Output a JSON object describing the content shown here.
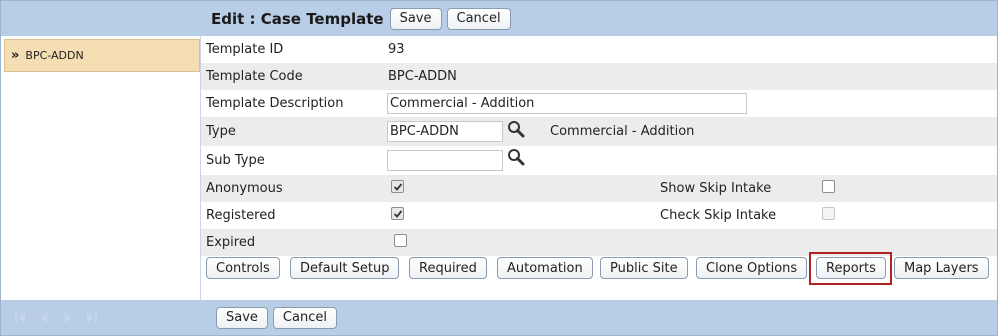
{
  "left": {
    "selected_item": "BPC-ADDN",
    "chevron": "»",
    "pager_icons": [
      "first-page-icon",
      "prev-page-icon",
      "next-page-icon",
      "last-page-icon"
    ]
  },
  "header": {
    "title": "Edit : Case Template",
    "save_label": "Save",
    "cancel_label": "Cancel"
  },
  "form": {
    "template_id_label": "Template ID",
    "template_id_value": "93",
    "template_code_label": "Template Code",
    "template_code_value": "BPC-ADDN",
    "template_description_label": "Template Description",
    "template_description_value": "Commercial - Addition",
    "type_label": "Type",
    "type_value": "BPC-ADDN",
    "type_description": "Commercial - Addition",
    "sub_type_label": "Sub Type",
    "sub_type_value": "",
    "anonymous_label": "Anonymous",
    "anonymous_checked": true,
    "show_skip_intake_label": "Show Skip Intake",
    "show_skip_intake_checked": false,
    "registered_label": "Registered",
    "registered_checked": true,
    "check_skip_intake_label": "Check Skip Intake",
    "check_skip_intake_checked": false,
    "expired_label": "Expired",
    "expired_checked": false
  },
  "actions": {
    "controls": "Controls",
    "default_setup": "Default Setup",
    "required": "Required",
    "automation": "Automation",
    "public_site": "Public Site",
    "clone_options": "Clone Options",
    "reports": "Reports",
    "map_layers": "Map Layers"
  },
  "footer": {
    "save_label": "Save",
    "cancel_label": "Cancel"
  },
  "colors": {
    "header_bg": "#b8cde6",
    "selected_item_bg": "#f5deb3",
    "highlight_border": "#b22222",
    "alt_row_bg": "#ececec"
  }
}
